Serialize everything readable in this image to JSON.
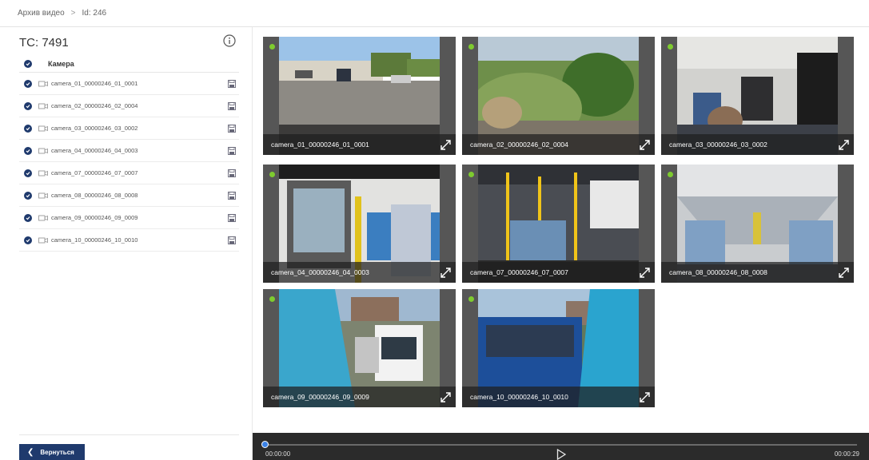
{
  "breadcrumb": {
    "root": "Архив видео",
    "separator": ">",
    "current": "Id: 246"
  },
  "sidebar": {
    "title": "ТС: 7491",
    "header_label": "Камера",
    "cameras": [
      "camera_01_00000246_01_0001",
      "camera_02_00000246_02_0004",
      "camera_03_00000246_03_0002",
      "camera_04_00000246_04_0003",
      "camera_07_00000246_07_0007",
      "camera_08_00000246_08_0008",
      "camera_09_00000246_09_0009",
      "camera_10_00000246_10_0010"
    ],
    "back_label": "Вернуться"
  },
  "tiles": [
    {
      "caption": "camera_01_00000246_01_0001",
      "scene": "parking"
    },
    {
      "caption": "camera_02_00000246_02_0004",
      "scene": "greenery"
    },
    {
      "caption": "camera_03_00000246_03_0002",
      "scene": "interior"
    },
    {
      "caption": "camera_04_00000246_04_0003",
      "scene": "door"
    },
    {
      "caption": "camera_07_00000246_07_0007",
      "scene": "interior-yellow"
    },
    {
      "caption": "camera_08_00000246_08_0008",
      "scene": "aisle"
    },
    {
      "caption": "camera_09_00000246_09_0009",
      "scene": "truck"
    },
    {
      "caption": "camera_10_00000246_10_0010",
      "scene": "bus"
    }
  ],
  "player": {
    "time_start": "00:00:00",
    "time_end": "00:00:29",
    "progress": 0
  },
  "colors": {
    "accent": "#1f3a6d",
    "status_dot": "#7ecb2f",
    "player_bg": "#2b2b2b",
    "slider": "#3b82e6"
  }
}
